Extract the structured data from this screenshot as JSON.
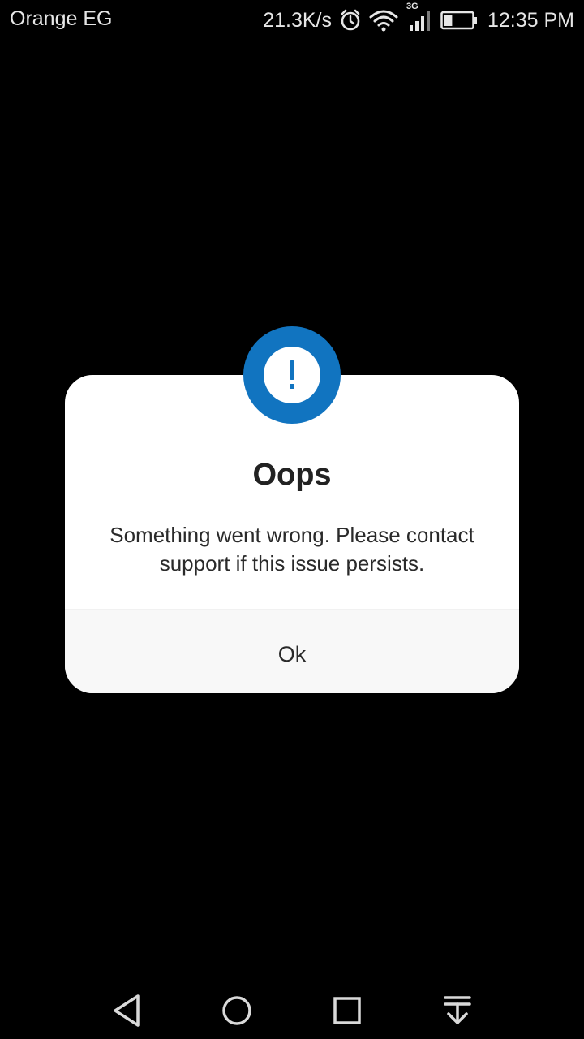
{
  "status_bar": {
    "carrier": "Orange EG",
    "net_speed": "21.3K/s",
    "network_type": "3G",
    "time": "12:35 PM",
    "icons": [
      "alarm-icon",
      "wifi-icon",
      "cell-signal-icon",
      "battery-icon"
    ],
    "battery_level": 0.3
  },
  "dialog": {
    "icon": "exclamation-icon",
    "accent_color": "#1174c0",
    "title": "Oops",
    "message": "Something went wrong. Please contact support if this issue persists.",
    "ok_label": "Ok"
  },
  "nav_bar": {
    "buttons": [
      "back-icon",
      "home-icon",
      "recents-icon",
      "notification-pull-icon"
    ]
  }
}
